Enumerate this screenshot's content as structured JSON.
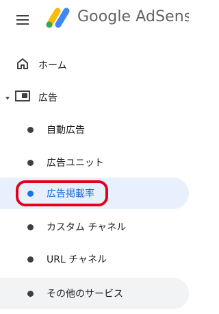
{
  "header": {
    "brand_google": "Google",
    "brand_product": "AdSense"
  },
  "nav": {
    "home": "ホーム",
    "ads": "広告",
    "auto_ads": "自動広告",
    "ad_units": "広告ユニット",
    "ad_placements": "広告掲載率",
    "custom_channels": "カスタム チャネル",
    "url_channels": "URL チャネル",
    "other_services": "その他のサービス"
  },
  "colors": {
    "accent": "#1a73e8",
    "selected_bg": "#e8f0fe",
    "highlight_ring": "#e3001b",
    "text": "#202124",
    "icon": "#3c4043"
  }
}
